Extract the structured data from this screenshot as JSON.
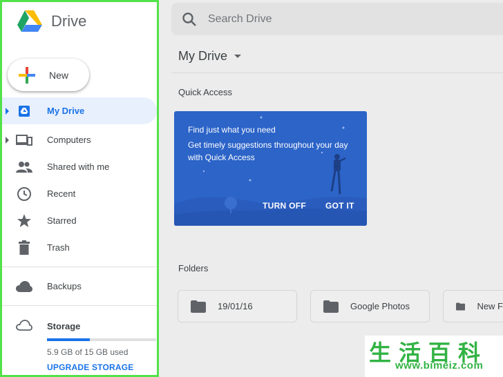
{
  "app": {
    "name": "Drive"
  },
  "new_button": {
    "label": "New"
  },
  "nav": {
    "items": [
      {
        "label": "My Drive",
        "icon": "my-drive-icon"
      },
      {
        "label": "Computers",
        "icon": "computers-icon"
      },
      {
        "label": "Shared with me",
        "icon": "shared-icon"
      },
      {
        "label": "Recent",
        "icon": "clock-icon"
      },
      {
        "label": "Starred",
        "icon": "star-icon"
      },
      {
        "label": "Trash",
        "icon": "trash-icon"
      }
    ],
    "backups": {
      "label": "Backups",
      "icon": "cloud-icon"
    },
    "storage": {
      "label": "Storage",
      "icon": "cloud-outline-icon",
      "used_text": "5.9 GB of 15 GB used",
      "used_fraction": 0.39,
      "upgrade_label": "UPGRADE STORAGE"
    }
  },
  "search": {
    "placeholder": "Search Drive"
  },
  "page": {
    "title": "My Drive"
  },
  "quick_access": {
    "label": "Quick Access",
    "card": {
      "title": "Find just what you need",
      "text": "Get timely suggestions throughout your day with Quick Access",
      "turn_off": "TURN OFF",
      "got_it": "GOT IT"
    }
  },
  "folders": {
    "label": "Folders",
    "items": [
      {
        "name": "19/01/16"
      },
      {
        "name": "Google Photos"
      },
      {
        "name": "New F"
      }
    ]
  },
  "watermark": {
    "chinese": "生活百科",
    "url": "www.bimeiz.com"
  },
  "colors": {
    "accent": "#1a73e8",
    "card": "#2c64c8",
    "highlight_border": "#53e24a",
    "watermark": "#32b344"
  }
}
